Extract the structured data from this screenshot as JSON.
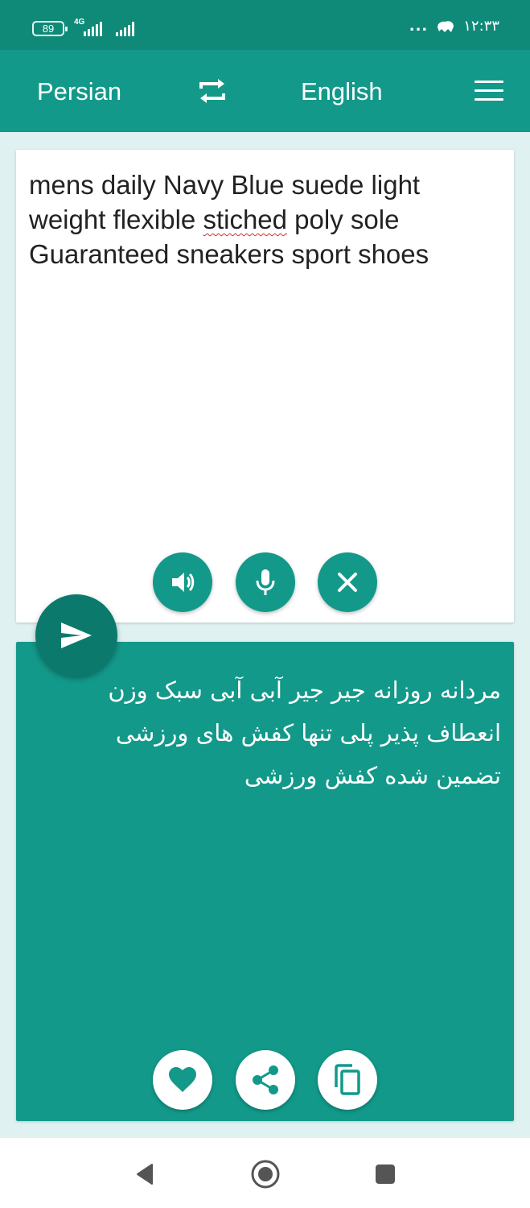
{
  "status_bar": {
    "battery": "89",
    "network": "4G",
    "dots": "...",
    "time": "۱۲:۳۳"
  },
  "app_bar": {
    "source_language": "Persian",
    "target_language": "English"
  },
  "input": {
    "text_before": "mens daily Navy Blue suede light weight flexible ",
    "misspelled_word": "stiched",
    "text_after": " poly sole Guaranteed sneakers sport shoes"
  },
  "output": {
    "text": "مردانه روزانه جیر جیر آبی آبی سبک وزن انعطاف پذیر پلی تنها کفش های ورزشی تضمین شده کفش ورزشی"
  },
  "icons": {
    "swap": "swap-arrows-icon",
    "menu": "hamburger-menu-icon",
    "speaker": "speaker-icon",
    "mic": "microphone-icon",
    "clear": "close-icon",
    "send": "send-icon",
    "favorite": "heart-icon",
    "share": "share-icon",
    "copy": "copy-icon",
    "back": "back-triangle-icon",
    "home": "home-circle-icon",
    "recents": "recents-square-icon"
  },
  "colors": {
    "status_bar": "#0f8a78",
    "primary": "#12998a",
    "send_button": "#0b7a6d",
    "background": "#dff1f1",
    "spell_error": "#d32f2f"
  }
}
